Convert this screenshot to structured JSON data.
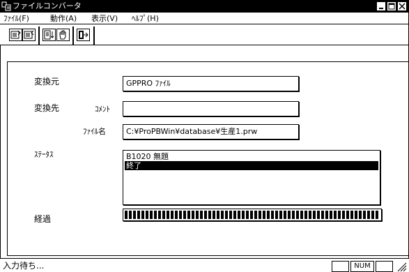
{
  "window": {
    "title": "ファイルコンバータ",
    "icon": "app-icon",
    "controls": [
      "minimize-icon",
      "maximize-icon",
      "close-icon"
    ]
  },
  "menubar": {
    "items": [
      "ﾌｧｲﾙ(F)",
      "動作(A)",
      "表示(V)",
      "ﾍﾙﾌﾟ(H)"
    ]
  },
  "toolbar": {
    "icons": [
      "open-file-icon",
      "save-file-icon",
      "convert-icon",
      "hand-icon",
      "exit-icon"
    ]
  },
  "form": {
    "source_label": "変換元",
    "source_value": "GPPRO ﾌｧｲﾙ",
    "dest_label": "変換先",
    "comment_label": "ｺﾒﾝﾄ",
    "comment_value": "",
    "filename_label": "ﾌｧｲﾙ名",
    "filename_value": "C:¥ProPBWin¥database¥生産1.prw",
    "status_label": "ｽﾃｰﾀｽ",
    "status_lines": [
      "B1020 無題",
      " 終了"
    ],
    "progress_label": "経過",
    "progress_fraction": 1.0
  },
  "statusbar": {
    "text": "入力待ち...",
    "num_indicator": "NUM"
  }
}
